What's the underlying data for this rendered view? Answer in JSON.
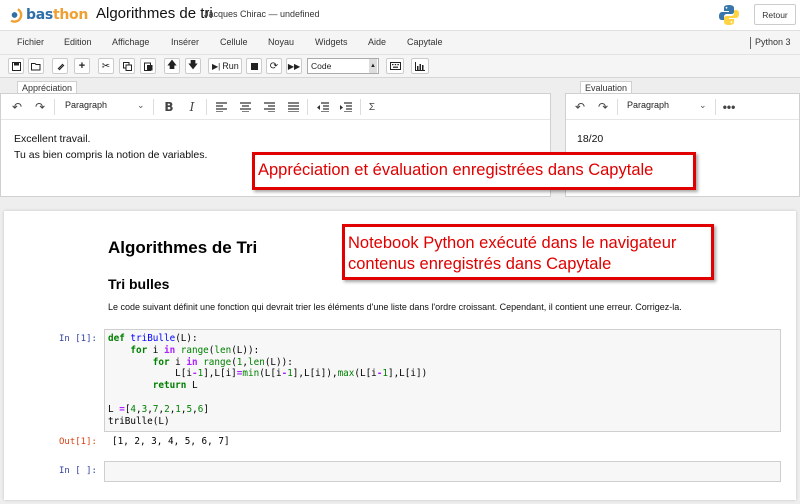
{
  "header": {
    "logo_prefix": "bas",
    "logo_suffix": "thon",
    "notebook_title": "Algorithmes de tri",
    "author": "Jacques Chirac — undefined",
    "return_label": "Retour"
  },
  "menu": {
    "items": [
      "Fichier",
      "Edition",
      "Affichage",
      "Insérer",
      "Cellule",
      "Noyau",
      "Widgets",
      "Aide",
      "Capytale"
    ],
    "kernel": "Python 3"
  },
  "toolbar": {
    "run_label": "Run",
    "cell_type": "Code"
  },
  "appreciation": {
    "tab_label": "Appréciation",
    "format": "Paragraph",
    "lines": [
      "Excellent travail.",
      "Tu as bien compris la notion de variables."
    ]
  },
  "evaluation": {
    "tab_label": "Evaluation",
    "format": "Paragraph",
    "value": "18/20"
  },
  "notebook": {
    "h1": "Algorithmes de Tri",
    "h2": "Tri bulles",
    "paragraph": "Le code suivant définit une fonction qui devrait trier les éléments d'une liste dans l'ordre croissant. Cependant, il contient une erreur. Corrigez-la.",
    "in_prompt_1": "In [1]:",
    "out_prompt_1": "Out[1]:",
    "output_1": "[1, 2, 3, 4, 5, 6, 7]",
    "in_prompt_empty": "In [ ]:"
  },
  "annotations": {
    "top": "Appréciation et évaluation enregistrées dans Capytale",
    "notebook_line1": "Notebook Python exécuté dans le navigateur",
    "notebook_line2": "contenus enregistrés dans Capytale"
  },
  "colors": {
    "annotation_red": "#e00000",
    "logo_blue": "#2f6fa8",
    "logo_orange": "#f0a030",
    "prompt_in": "#303f9f",
    "prompt_out": "#d84315"
  }
}
